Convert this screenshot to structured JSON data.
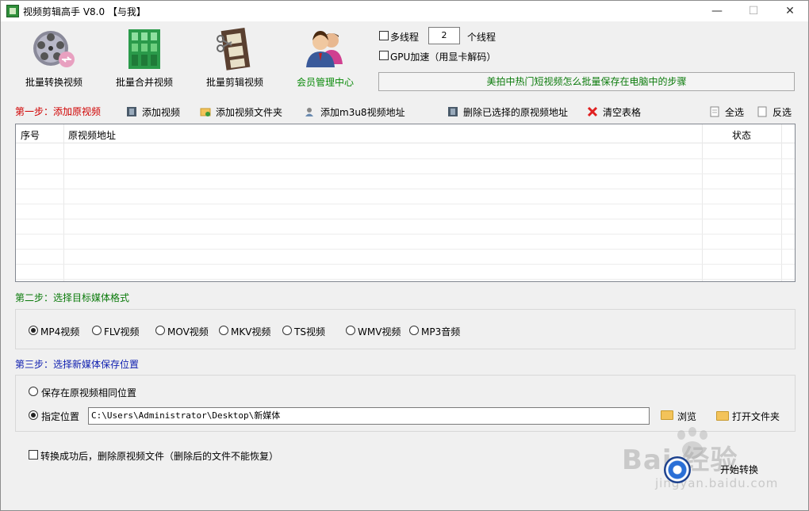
{
  "window": {
    "title": "视频剪辑高手 V8.0  【与我】",
    "minimize": "—",
    "maximize": "☐",
    "close": "✕"
  },
  "tools": [
    {
      "label": "批量转换视频"
    },
    {
      "label": "批量合并视频"
    },
    {
      "label": "批量剪辑视频"
    },
    {
      "label": "会员管理中心",
      "color": "#0a8a0a"
    }
  ],
  "options": {
    "multithread_label": "多线程",
    "thread_count": "2",
    "thread_unit": "个线程",
    "gpu_label": "GPU加速（用显卡解码）"
  },
  "marquee": "美拍中热门短视频怎么批量保存在电脑中的步骤",
  "step1": {
    "title": "第一步：添加原视频",
    "color": "#d00000",
    "add_video": "添加视频",
    "add_folder": "添加视频文件夹",
    "add_m3u8": "添加m3u8视频地址",
    "delete_selected": "删除已选择的原视频地址",
    "clear_table": "清空表格",
    "select_all": "全选",
    "invert": "反选"
  },
  "table": {
    "columns": [
      "序号",
      "原视频地址",
      "状态"
    ]
  },
  "step2": {
    "title": "第二步：选择目标媒体格式",
    "color": "#0a7a0a",
    "formats": [
      "MP4视频",
      "FLV视频",
      "MOV视频",
      "MKV视频",
      "TS视频",
      "WMV视频",
      "MP3音频"
    ],
    "selected": "MP4视频"
  },
  "step3": {
    "title": "第三步：选择新媒体保存位置",
    "color": "#1020b0",
    "same_location": "保存在原视频相同位置",
    "custom_location": "指定位置",
    "path": "C:\\Users\\Administrator\\Desktop\\新媒体",
    "browse": "浏览",
    "open_folder": "打开文件夹"
  },
  "footer": {
    "delete_after": "转换成功后，删除原视频文件（删除后的文件不能恢复）",
    "start": "开始转换"
  },
  "watermark": {
    "main": "Bai  经验",
    "sub": "jingyan.baidu.com"
  }
}
